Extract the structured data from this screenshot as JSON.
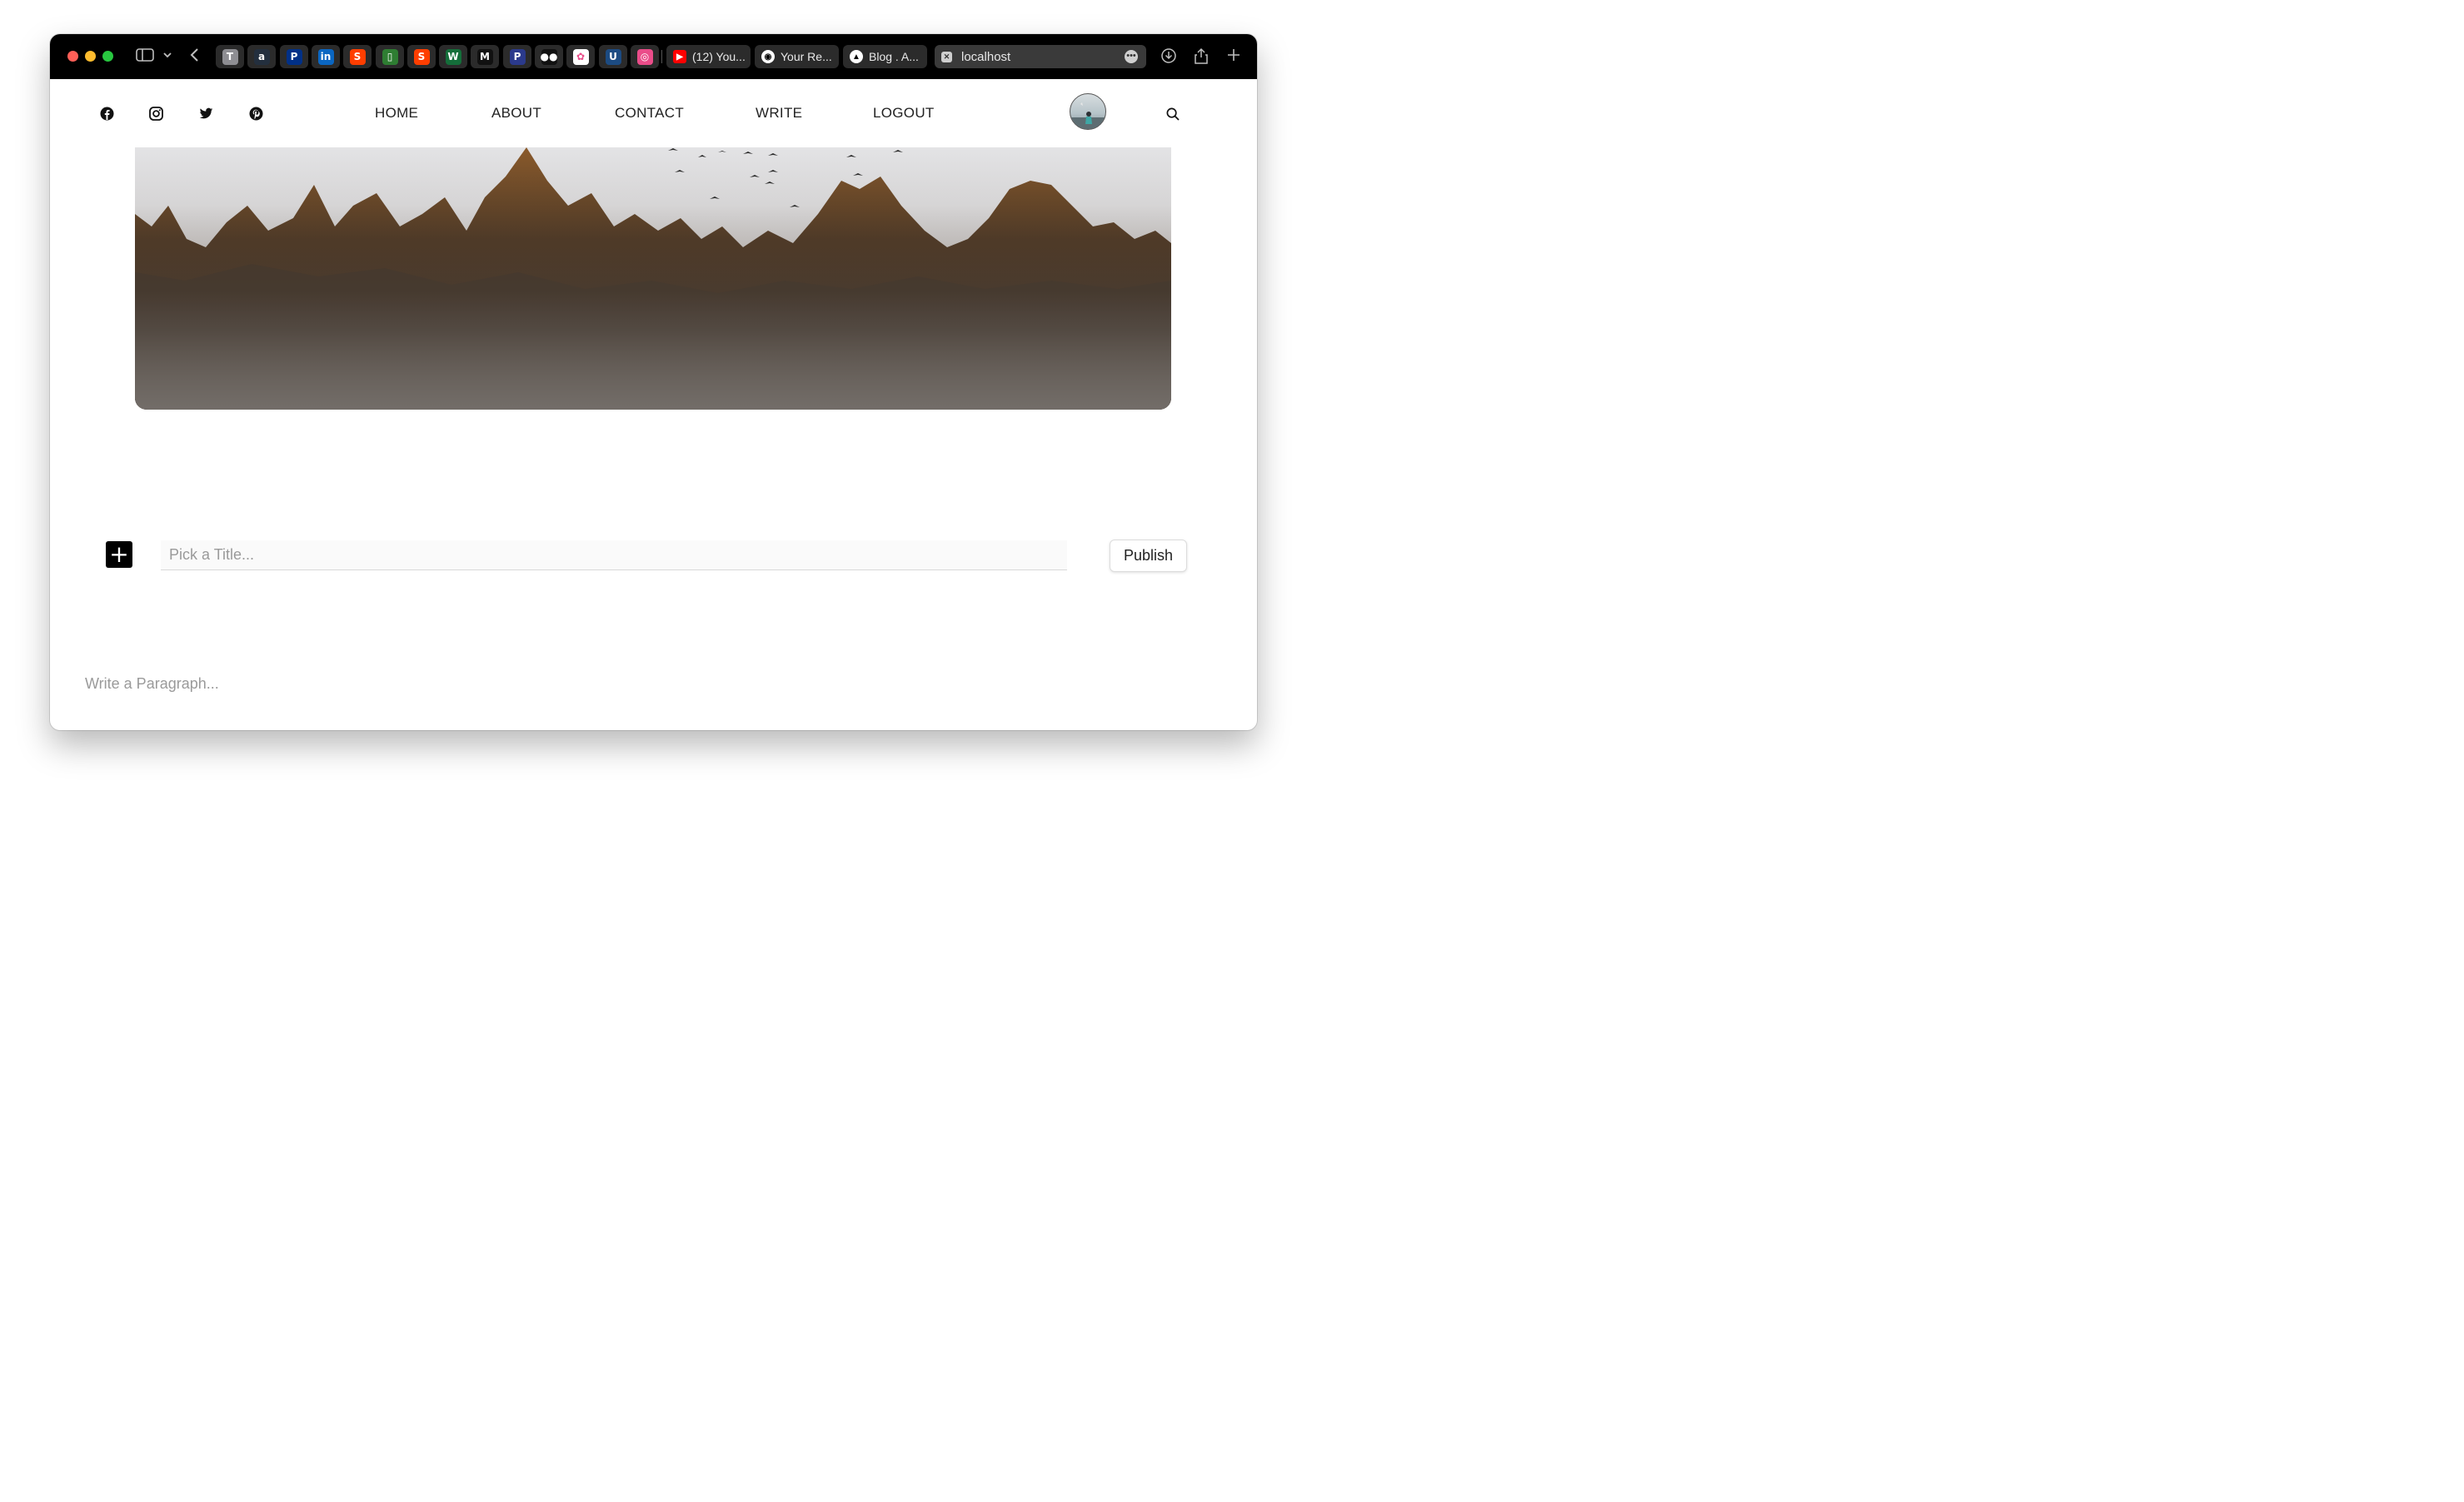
{
  "browser": {
    "pinned_tabs": [
      {
        "icon": "t-letter-icon",
        "glyph": "T",
        "bg": "#8e8e93"
      },
      {
        "icon": "amazon-icon",
        "glyph": "a",
        "bg": "#232f3e"
      },
      {
        "icon": "paypal-icon",
        "glyph": "P",
        "bg": "#003087"
      },
      {
        "icon": "linkedin-icon",
        "glyph": "in",
        "bg": "#0a66c2"
      },
      {
        "icon": "svelte-icon",
        "glyph": "S",
        "bg": "#ff3e00"
      },
      {
        "icon": "green-book-icon",
        "glyph": "▯",
        "bg": "#2e7d32"
      },
      {
        "icon": "svelte-icon",
        "glyph": "S",
        "bg": "#ff3e00"
      },
      {
        "icon": "webflow-icon",
        "glyph": "W",
        "bg": "#146e3a"
      },
      {
        "icon": "medium-icon",
        "glyph": "M",
        "bg": "#111111"
      },
      {
        "icon": "producthunt-icon",
        "glyph": "P",
        "bg": "#2b3a8c"
      },
      {
        "icon": "medium-dots-icon",
        "glyph": "●●",
        "bg": "#111111"
      },
      {
        "icon": "figma-icon",
        "glyph": "✿",
        "bg": "#ffffff"
      },
      {
        "icon": "udemy-icon",
        "glyph": "U",
        "bg": "#1c4b82"
      },
      {
        "icon": "dribbble-icon",
        "glyph": "◎",
        "bg": "#ea4c89"
      }
    ],
    "tabs": [
      {
        "icon": "youtube-icon",
        "label": "(12) You...",
        "color": "#ff0000"
      },
      {
        "icon": "github-icon",
        "label": "Your Re...",
        "color": "#ffffff"
      },
      {
        "icon": "vercel-icon",
        "label": "Blog . A...",
        "color": "#ffffff"
      },
      {
        "icon": "localhost-icon",
        "label": "localhost",
        "color": "#cccccc"
      }
    ]
  },
  "nav": {
    "menu": [
      "HOME",
      "ABOUT",
      "CONTACT",
      "WRITE",
      "LOGOUT"
    ]
  },
  "editor": {
    "add_label": "+",
    "title_placeholder": "Pick a Title...",
    "publish_label": "Publish",
    "paragraph_placeholder": "Write a Paragraph..."
  }
}
